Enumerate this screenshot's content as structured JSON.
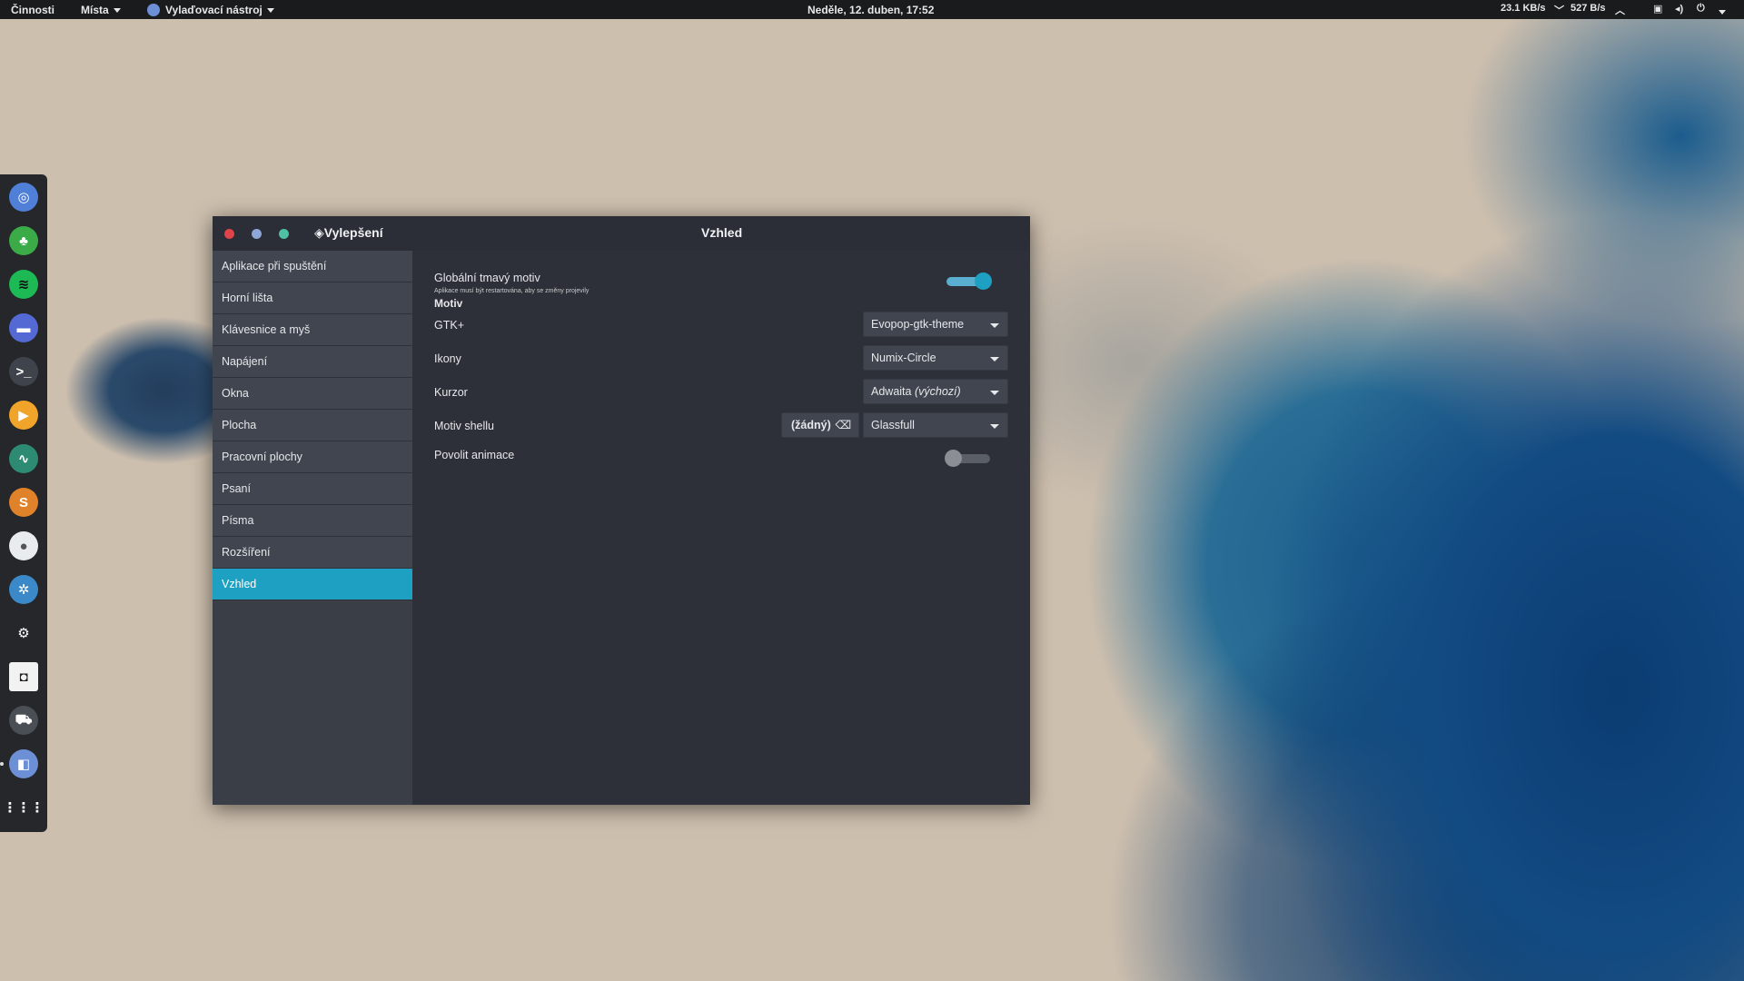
{
  "topbar": {
    "activities": "Činnosti",
    "places": "Místa",
    "app_menu": "Vylaďovací nástroj",
    "clock": "Neděle, 12. duben, 17:52",
    "net_down": "23.1 KB/s",
    "net_up": "527 B/s"
  },
  "dock": {
    "items": [
      "chromium-icon",
      "evernote-icon",
      "spotify-icon",
      "files-icon",
      "terminal-icon",
      "media-player-icon",
      "system-monitor-icon",
      "sublime-icon",
      "cloud-icon",
      "network-icon",
      "steam-icon",
      "inkscape-icon",
      "truck-game-icon",
      "tweaks-icon",
      "app-grid-icon"
    ]
  },
  "window": {
    "app_title": "Vylepšení",
    "page_title": "Vzhled",
    "sidebar": [
      "Aplikace při spuštění",
      "Horní lišta",
      "Klávesnice a myš",
      "Napájení",
      "Okna",
      "Plocha",
      "Pracovní plochy",
      "Psaní",
      "Písma",
      "Rozšíření",
      "Vzhled"
    ],
    "selected": "Vzhled",
    "dark_theme": {
      "label": "Globální tmavý motiv",
      "note": "Aplikace musí být restartována, aby se změny projevily",
      "enabled": true
    },
    "theme_section": "Motiv",
    "gtk": {
      "label": "GTK+",
      "value": "Evopop-gtk-theme"
    },
    "icons": {
      "label": "Ikony",
      "value": "Numix-Circle"
    },
    "cursor": {
      "label": "Kurzor",
      "value": "Adwaita",
      "value_suffix": "(výchozí)"
    },
    "shell": {
      "label": "Motiv shellu",
      "none_button": "(žádný)",
      "value": "Glassfull"
    },
    "animations": {
      "label": "Povolit animace",
      "enabled": false
    }
  },
  "colors": {
    "accent": "#1ea0c3",
    "close": "#e0434a",
    "minimize": "#8fa6d9",
    "maximize": "#4ec0a5"
  }
}
